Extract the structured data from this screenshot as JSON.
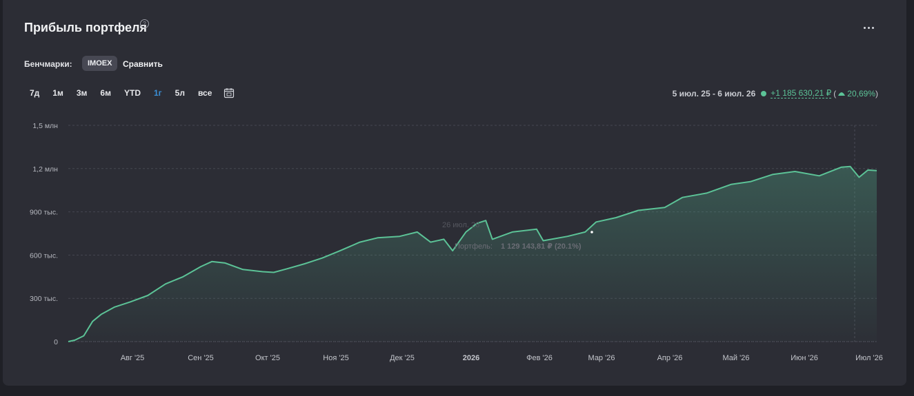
{
  "header": {
    "title": "Прибыль портфеля",
    "help_glyph": "?",
    "more_icon": "more-horizontal-icon"
  },
  "benchmarks": {
    "label": "Бенчмарки:",
    "selected": "IMOEX",
    "compare_label": "Сравнить"
  },
  "periods": [
    {
      "label": "7д",
      "active": false
    },
    {
      "label": "1м",
      "active": false
    },
    {
      "label": "3м",
      "active": false
    },
    {
      "label": "6м",
      "active": false
    },
    {
      "label": "YTD",
      "active": false
    },
    {
      "label": "1г",
      "active": true
    },
    {
      "label": "5л",
      "active": false
    },
    {
      "label": "все",
      "active": false
    }
  ],
  "calendar_icon": "calendar-icon",
  "range": {
    "dates": "5 июл. 25 - 6 июл. 26",
    "abs_change": "+1 185 630,21 ₽",
    "pct_change": "20,69%",
    "open_paren": "(",
    "close_paren": ")",
    "trend_icon": "up-triangle-icon"
  },
  "tooltip": {
    "date": "26 июл. 26",
    "series_label": "Портфель:",
    "value": "1 129 143,81 ₽ (20.1%)"
  },
  "colors": {
    "accent_green": "#5cc397",
    "active_period": "#3a8fd6",
    "background": "#2c2d35"
  },
  "chart_data": {
    "type": "area",
    "series": [
      {
        "points": [
          [
            "2025-07-05",
            0
          ],
          [
            "2025-07-08",
            10000
          ],
          [
            "2025-07-12",
            40000
          ],
          [
            "2025-07-16",
            140000
          ],
          [
            "2025-07-20",
            190000
          ],
          [
            "2025-07-26",
            240000
          ],
          [
            "2025-08-02",
            275000
          ],
          [
            "2025-08-10",
            320000
          ],
          [
            "2025-08-18",
            400000
          ],
          [
            "2025-08-26",
            450000
          ],
          [
            "2025-09-03",
            520000
          ],
          [
            "2025-09-08",
            555000
          ],
          [
            "2025-09-14",
            545000
          ],
          [
            "2025-09-22",
            500000
          ],
          [
            "2025-10-01",
            485000
          ],
          [
            "2025-10-06",
            480000
          ],
          [
            "2025-10-12",
            505000
          ],
          [
            "2025-10-20",
            540000
          ],
          [
            "2025-10-28",
            580000
          ],
          [
            "2025-11-05",
            630000
          ],
          [
            "2025-11-14",
            690000
          ],
          [
            "2025-11-22",
            720000
          ],
          [
            "2025-12-02",
            730000
          ],
          [
            "2025-12-10",
            760000
          ],
          [
            "2025-12-16",
            690000
          ],
          [
            "2025-12-22",
            710000
          ],
          [
            "2025-12-26",
            630000
          ],
          [
            "2026-01-01",
            760000
          ],
          [
            "2026-01-06",
            820000
          ],
          [
            "2026-01-10",
            840000
          ],
          [
            "2026-01-13",
            710000
          ],
          [
            "2026-01-22",
            760000
          ],
          [
            "2026-02-02",
            780000
          ],
          [
            "2026-02-05",
            700000
          ],
          [
            "2026-02-16",
            730000
          ],
          [
            "2026-02-24",
            760000
          ],
          [
            "2026-03-01",
            830000
          ],
          [
            "2026-03-10",
            860000
          ],
          [
            "2026-03-20",
            910000
          ],
          [
            "2026-04-01",
            930000
          ],
          [
            "2026-04-09",
            1000000
          ],
          [
            "2026-04-20",
            1030000
          ],
          [
            "2026-05-01",
            1090000
          ],
          [
            "2026-05-10",
            1110000
          ],
          [
            "2026-05-20",
            1160000
          ],
          [
            "2026-05-30",
            1180000
          ],
          [
            "2026-06-10",
            1150000
          ],
          [
            "2026-06-20",
            1210000
          ],
          [
            "2026-06-24",
            1215000
          ],
          [
            "2026-06-28",
            1140000
          ],
          [
            "2026-07-02",
            1190000
          ],
          [
            "2026-07-06",
            1185630
          ]
        ]
      }
    ],
    "x_tick_labels": [
      "Авг '25",
      "Сен '25",
      "Окт '25",
      "Ноя '25",
      "Дек '25",
      "2026",
      "Фев '26",
      "Мар '26",
      "Апр '26",
      "Май '26",
      "Июн '26",
      "Июл '26"
    ],
    "y_ticks": [
      0,
      300000,
      600000,
      900000,
      1200000,
      1500000
    ],
    "y_tick_labels": [
      "0",
      "300 тыс.",
      "600 тыс.",
      "900 тыс.",
      "1,2 млн",
      "1,5 млн"
    ],
    "xlim": [
      "2025-07-05",
      "2026-07-06"
    ],
    "ylim": [
      0,
      1500000
    ],
    "grid": true
  }
}
